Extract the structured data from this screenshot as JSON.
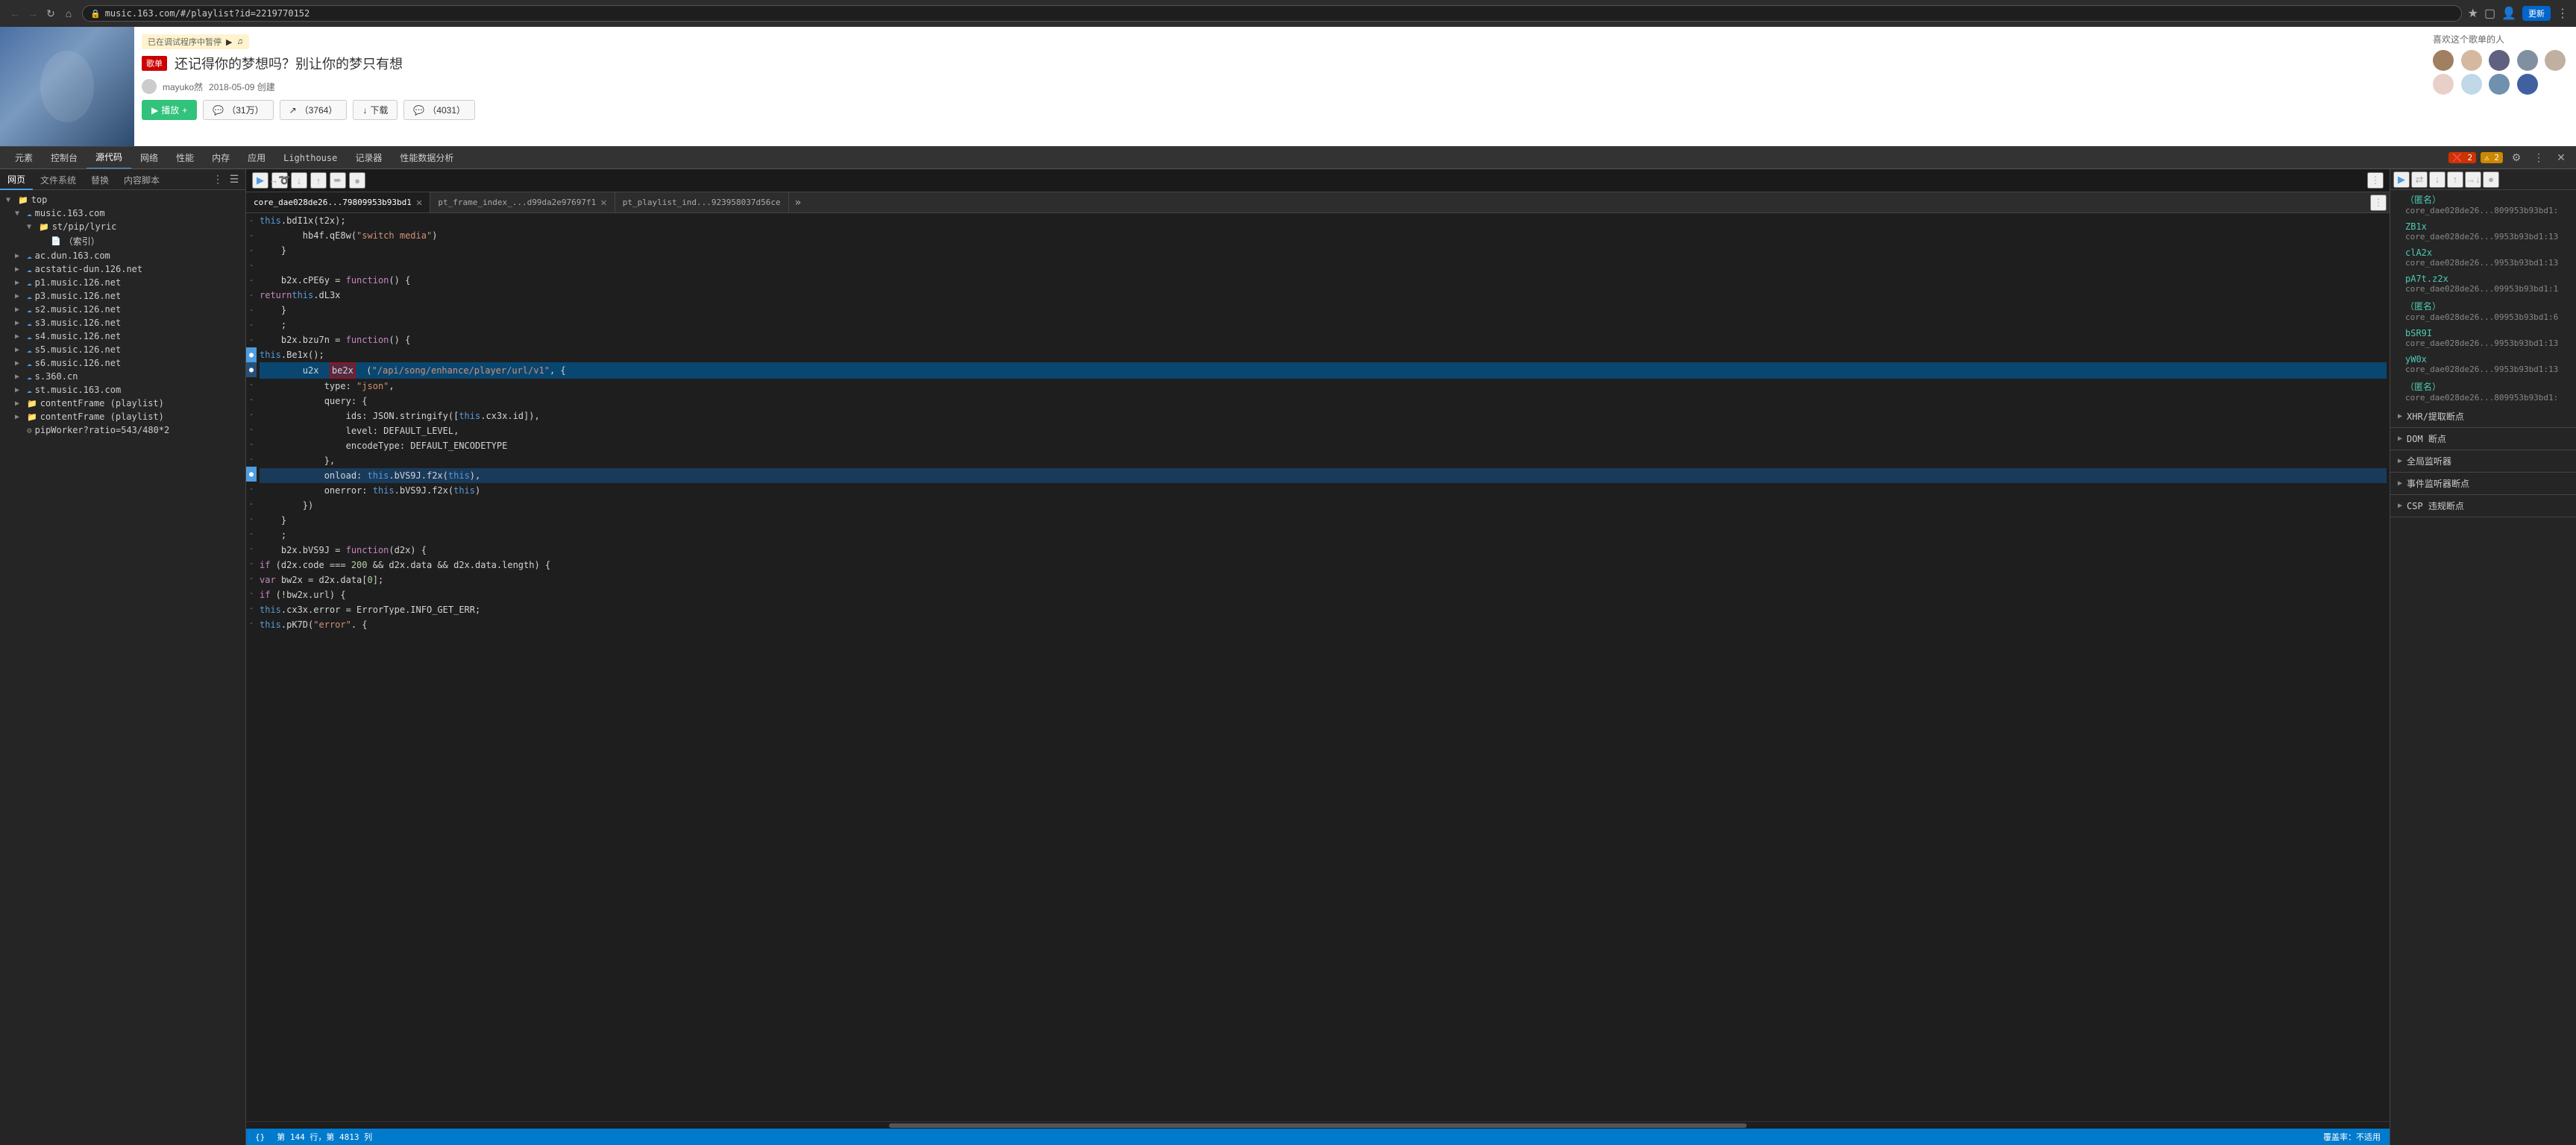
{
  "browser": {
    "url": "music.163.com/#/playlist?id=2219770152",
    "update_label": "更新",
    "tabs": {
      "elements": "元素",
      "console": "控制台",
      "sources": "源代码",
      "network": "网络",
      "performance": "性能",
      "memory": "内存",
      "application": "应用",
      "lighthouse": "Lighthouse",
      "recorder": "记录器",
      "performance_insights": "性能数据分析"
    }
  },
  "page": {
    "song_badge": "歌单",
    "song_title": "还记得你的梦想吗？别让你的梦只有想",
    "debug_notice": "已在调试程序中暂停",
    "user": "mayuko然",
    "date": "2018-05-09 创建",
    "fans_title": "喜欢这个歌单的人",
    "play_label": "播放",
    "count1": "（31万）",
    "count2": "（3764）",
    "download": "下载",
    "count3": "（4031）"
  },
  "file_tree": {
    "tabs": {
      "page": "网页",
      "filesystem": "文件系统",
      "overrides": "替换",
      "content_scripts": "内容脚本"
    },
    "items": [
      {
        "label": "top",
        "type": "folder",
        "level": 0
      },
      {
        "label": "music.163.com",
        "type": "cloud",
        "level": 1
      },
      {
        "label": "st/pip/lyric",
        "type": "folder",
        "level": 2
      },
      {
        "label": "（索引）",
        "type": "file",
        "level": 3
      },
      {
        "label": "ac.dun.163.com",
        "type": "cloud",
        "level": 1
      },
      {
        "label": "acstatic-dun.126.net",
        "type": "cloud",
        "level": 1
      },
      {
        "label": "p1.music.126.net",
        "type": "cloud",
        "level": 1
      },
      {
        "label": "p3.music.126.net",
        "type": "cloud",
        "level": 1
      },
      {
        "label": "s2.music.126.net",
        "type": "cloud",
        "level": 1
      },
      {
        "label": "s3.music.126.net",
        "type": "cloud",
        "level": 1
      },
      {
        "label": "s4.music.126.net",
        "type": "cloud",
        "level": 1
      },
      {
        "label": "s5.music.126.net",
        "type": "cloud",
        "level": 1
      },
      {
        "label": "s6.music.126.net",
        "type": "cloud",
        "level": 1
      },
      {
        "label": "s.360.cn",
        "type": "cloud",
        "level": 1
      },
      {
        "label": "st.music.163.com",
        "type": "cloud",
        "level": 1
      },
      {
        "label": "contentFrame (playlist)",
        "type": "folder",
        "level": 1
      },
      {
        "label": "contentFrame (playlist)",
        "type": "folder",
        "level": 1
      },
      {
        "label": "pipWorker?ratio=543/480*2",
        "type": "gear",
        "level": 1
      }
    ]
  },
  "code_editor": {
    "tabs": [
      {
        "label": "core_dae028de26...79809953b93bd1",
        "active": true
      },
      {
        "label": "pt_frame_index_...d99da2e97697f1",
        "active": false
      },
      {
        "label": "pt_playlist_ind...923958037d56ce",
        "active": false
      }
    ],
    "lines": [
      {
        "num": "",
        "gutter": "-",
        "content": "        this.bdI1x(t2x);"
      },
      {
        "num": "",
        "gutter": "-",
        "content": "        hb4f.qE8w(\"switch media\")"
      },
      {
        "num": "",
        "gutter": "-",
        "content": "    }"
      },
      {
        "num": "",
        "gutter": "-",
        "content": ""
      },
      {
        "num": "",
        "gutter": "-",
        "content": "    b2x.cPE6y = function() {"
      },
      {
        "num": "",
        "gutter": "-",
        "content": "        return this.dL3x"
      },
      {
        "num": "",
        "gutter": "-",
        "content": "    }"
      },
      {
        "num": "",
        "gutter": "-",
        "content": "    ;"
      },
      {
        "num": "",
        "gutter": "-",
        "content": "    b2x.bzu7n = function() {"
      },
      {
        "num": "",
        "gutter": "●",
        "content": "        this.Be1x();"
      },
      {
        "num": "",
        "gutter": "●",
        "content": "        u2x  be2x  (\"/api/song/enhance/player/url/v1\", {",
        "highlighted": true
      },
      {
        "num": "",
        "gutter": "-",
        "content": "            type: \"json\","
      },
      {
        "num": "",
        "gutter": "-",
        "content": "            query: {"
      },
      {
        "num": "",
        "gutter": "-",
        "content": "                ids: JSON.stringify([this.cx3x.id]),"
      },
      {
        "num": "",
        "gutter": "-",
        "content": "                level: DEFAULT_LEVEL,"
      },
      {
        "num": "",
        "gutter": "-",
        "content": "                encodeType: DEFAULT_ENCODETYPE"
      },
      {
        "num": "",
        "gutter": "-",
        "content": "            },"
      },
      {
        "num": "",
        "gutter": "●",
        "content": "            onload: this.bVS9J.f2x(this),",
        "breakpoint": true
      },
      {
        "num": "",
        "gutter": "-",
        "content": "            onerror: this.bVS9J.f2x(this)"
      },
      {
        "num": "",
        "gutter": "-",
        "content": "        })"
      },
      {
        "num": "",
        "gutter": "-",
        "content": "    }"
      },
      {
        "num": "",
        "gutter": "-",
        "content": "    ;"
      },
      {
        "num": "",
        "gutter": "-",
        "content": "    b2x.bVS9J = function(d2x) {"
      },
      {
        "num": "",
        "gutter": "-",
        "content": "        if (d2x.code === 200 && d2x.data && d2x.data.length) {"
      },
      {
        "num": "",
        "gutter": "-",
        "content": "            var bw2x = d2x.data[0];"
      },
      {
        "num": "",
        "gutter": "-",
        "content": "            if (!bw2x.url) {"
      },
      {
        "num": "",
        "gutter": "-",
        "content": "                this.cx3x.error = ErrorType.INFO_GET_ERR;"
      },
      {
        "num": "",
        "gutter": "-",
        "content": "                this.pK7D(\"error\". {"
      }
    ],
    "status": {
      "line": "第 144 行，第 4813 列",
      "coverage": "覆盖率：不适用"
    }
  },
  "right_panel": {
    "sections": {
      "xhrBreakpoints": "XHR/提取断点",
      "domBreakpoints": "DOM 断点",
      "globalListeners": "全局监听器",
      "eventListeners": "事件监听器断点",
      "cspViolations": "CSP 违规断点"
    },
    "items": [
      {
        "name": "（匿名）",
        "file": "core_dae028de26...809953b93bd1:",
        "line": ""
      },
      {
        "name": "ZB1x",
        "file": "core_dae028de26...9953b93bd1:13",
        "line": ""
      },
      {
        "name": "clA2x",
        "file": "core_dae028de26...9953b93bd1:13",
        "line": ""
      },
      {
        "name": "pA7t.z2x",
        "file": "core_dae028de26...09953b93bd1:1",
        "line": ""
      },
      {
        "name": "（匿名）",
        "file": "core_dae028de26...09953b93bd1:6",
        "line": ""
      },
      {
        "name": "bSR9I",
        "file": "core_dae028de26...9953b93bd1:13",
        "line": ""
      },
      {
        "name": "yW0x",
        "file": "core_dae028de26...9953b93bd1:13",
        "line": ""
      },
      {
        "name": "（匿名）",
        "file": "core_dae028de26...809953b93bd1:",
        "line": ""
      }
    ]
  }
}
